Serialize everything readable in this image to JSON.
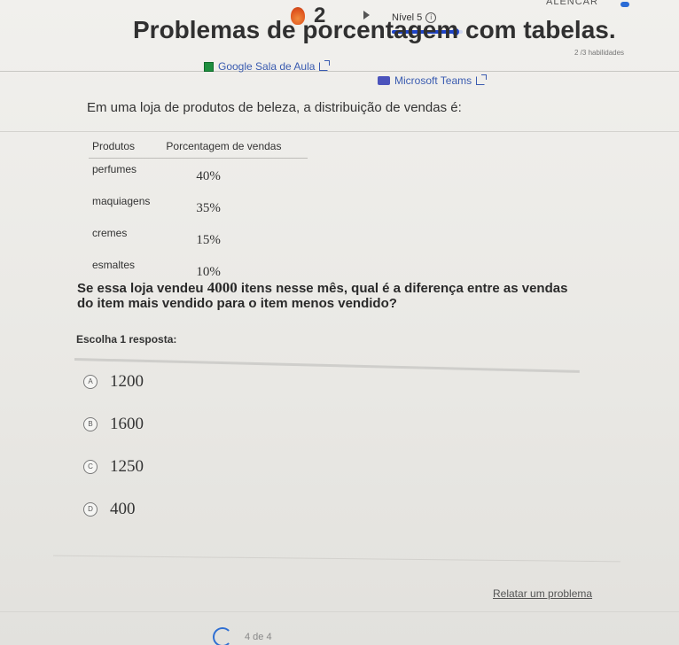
{
  "topbar": {
    "streak_count": "2",
    "level_label": "Nível 5",
    "info_glyph": "i",
    "level_progress_percent": 90,
    "corner_text": "ALENCAR",
    "skills_label": "2 /3 habilidades"
  },
  "title": "Problemas de porcentagem com tabelas.",
  "links": {
    "google": "Google Sala de Aula",
    "teams": "Microsoft Teams"
  },
  "intro": "Em uma loja de produtos de beleza, a distribuição de vendas é:",
  "table": {
    "headers": [
      "Produtos",
      "Porcentagem de vendas"
    ],
    "rows": [
      [
        "perfumes",
        "40%"
      ],
      [
        "maquiagens",
        "35%"
      ],
      [
        "cremes",
        "15%"
      ],
      [
        "esmaltes",
        "10%"
      ]
    ]
  },
  "question": {
    "before": "Se essa loja vendeu ",
    "number": "4000",
    "after": " itens nesse mês, qual é a diferença entre as vendas do item mais vendido para o item menos vendido?"
  },
  "choose_label": "Escolha 1 resposta:",
  "options": [
    {
      "letter": "A",
      "value": "1200"
    },
    {
      "letter": "B",
      "value": "1600"
    },
    {
      "letter": "C",
      "value": "1250"
    },
    {
      "letter": "D",
      "value": "400"
    }
  ],
  "report_link": "Relatar um problema",
  "pager": "4 de 4"
}
